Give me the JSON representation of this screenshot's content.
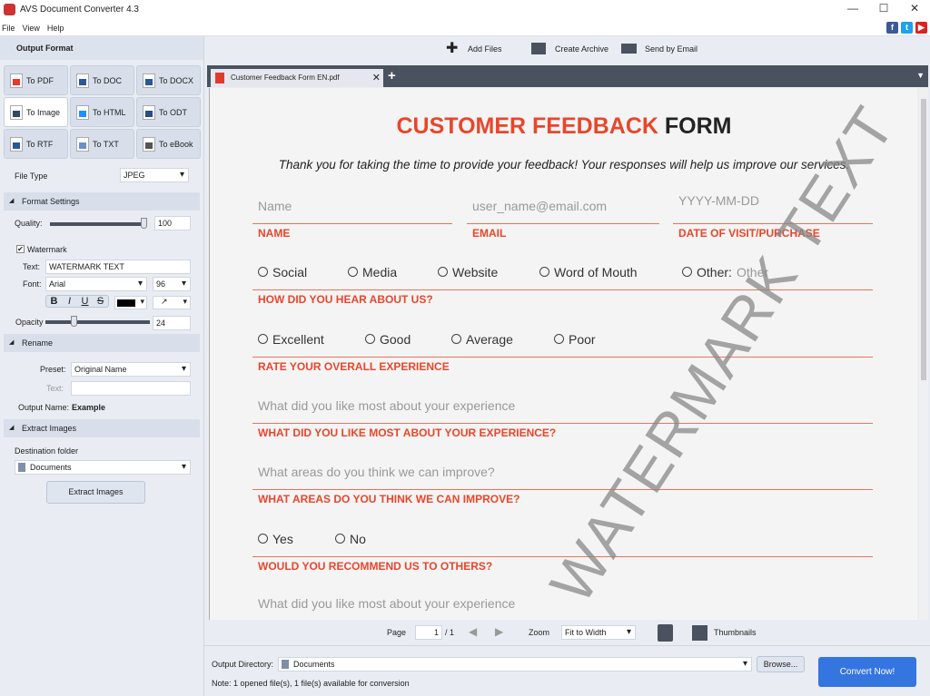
{
  "window": {
    "title": "AVS Document Converter 4.3",
    "controls": [
      "—",
      "☐",
      "✕"
    ]
  },
  "menu": [
    "File",
    "View",
    "Help"
  ],
  "social": [
    "f",
    "t",
    "▶"
  ],
  "left": {
    "output_format_title": "Output Format",
    "formats": [
      {
        "label": "To PDF",
        "color": "#e03a2e"
      },
      {
        "label": "To DOC",
        "color": "#2b5797"
      },
      {
        "label": "To DOCX",
        "color": "#2b5797"
      },
      {
        "label": "To Image",
        "color": "#34495e"
      },
      {
        "label": "To HTML",
        "color": "#1e90ff"
      },
      {
        "label": "To ODT",
        "color": "#2b4a8a"
      },
      {
        "label": "To RTF",
        "color": "#2b5797"
      },
      {
        "label": "To TXT",
        "color": "#6d8fc7"
      },
      {
        "label": "To eBook",
        "color": "#555"
      }
    ],
    "file_type_label": "File Type",
    "file_type": "JPEG",
    "format_settings": "Format Settings",
    "quality_label": "Quality:",
    "quality": "100",
    "quality_fraction": 1.0,
    "watermark_label": "Watermark",
    "watermark_checked": true,
    "text_label": "Text:",
    "text_value": "WATERMARK TEXT",
    "font_label": "Font:",
    "font_value": "Arial",
    "font_size": "96",
    "style_buttons": [
      "B",
      "I",
      "U",
      "S"
    ],
    "opacity_label": "Opacity",
    "opacity": "24",
    "opacity_fraction": 0.24,
    "rename": "Rename",
    "preset_label": "Preset:",
    "preset_value": "Original Name",
    "rename_text_label": "Text:",
    "rename_text_value": "",
    "output_name_label": "Output Name:",
    "output_name_value": "Example",
    "extract_images": "Extract Images",
    "dest_label": "Destination folder",
    "dest_value": "Documents",
    "extract_button": "Extract Images"
  },
  "toolbar": {
    "add_files": "Add Files",
    "create_archive": "Create Archive",
    "send_email": "Send by Email"
  },
  "tab": {
    "name": "Customer Feedback Form EN.pdf",
    "close": "✕",
    "add": "+"
  },
  "doc": {
    "title_red": "CUSTOMER FEEDBACK",
    "title_black": "FORM",
    "subtitle": "Thank you for taking the time to provide your feedback! Your responses will help us improve our services.",
    "name_ph": "Name",
    "email_ph": "user_name@email.com",
    "date_ph": "YYYY-MM-DD",
    "name_label": "NAME",
    "email_label": "EMAIL",
    "date_label": "DATE OF VISIT/PURCHASE",
    "hear_options": [
      "Social",
      "Media",
      "Website",
      "Word of Mouth",
      "Other:"
    ],
    "other_ph": "Other",
    "hear_label": "HOW DID YOU HEAR ABOUT US?",
    "rate_options": [
      "Excellent",
      "Good",
      "Average",
      "Poor"
    ],
    "rate_label": "RATE YOUR OVERALL EXPERIENCE",
    "like_ph": "What did you like most about your experience",
    "like_label": "WHAT DID YOU LIKE MOST ABOUT YOUR EXPERIENCE?",
    "improve_ph": "What areas do you think we can improve?",
    "improve_label": "WHAT AREAS DO YOU THINK WE CAN IMPROVE?",
    "rec_options": [
      "Yes",
      "No"
    ],
    "rec_label": "WOULD YOU RECOMMEND US TO OTHERS?",
    "last_ph": "What did you like most about your experience",
    "watermark": "WATERMARK TEXT"
  },
  "nav": {
    "page_label": "Page",
    "page": "1",
    "of": "/ 1",
    "zoom_label": "Zoom",
    "zoom_value": "Fit to Width",
    "thumbnails": "Thumbnails"
  },
  "bottom": {
    "output_dir_label": "Output Directory:",
    "output_dir": "Documents",
    "browse": "Browse...",
    "convert": "Convert Now!",
    "note": "Note: 1 opened file(s), 1 file(s) available for conversion"
  }
}
